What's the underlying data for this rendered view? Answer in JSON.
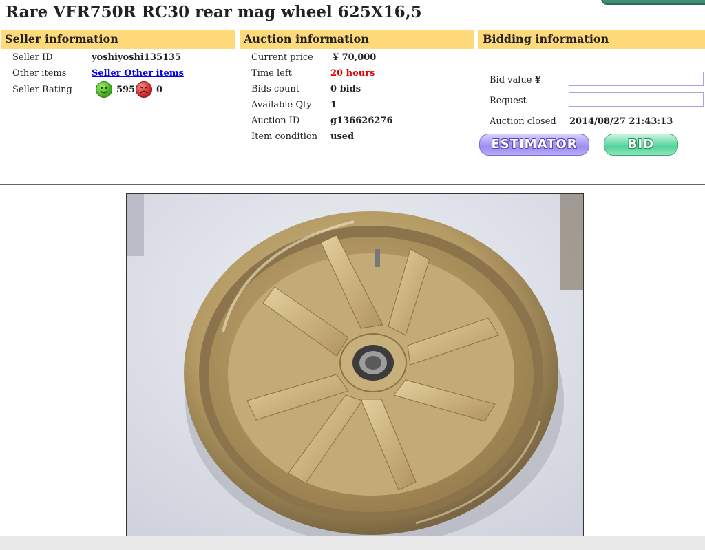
{
  "page": {
    "title": "Rare VFR750R RC30 rear mag wheel 625X16,5"
  },
  "seller": {
    "header": "Seller information",
    "id_label": "Seller ID",
    "id_value": "yoshiyoshi135135",
    "other_label": "Other items",
    "other_link": "Seller Other items",
    "rating_label": "Seller Rating",
    "good_count": "595",
    "bad_count": "0"
  },
  "auction": {
    "header": "Auction information",
    "rows": [
      {
        "label": "Current price",
        "value": "¥ 70,000"
      },
      {
        "label": "Time left",
        "value": "20 hours"
      },
      {
        "label": "Bids count",
        "value": "0 bids"
      },
      {
        "label": "Available Qty",
        "value": "1"
      },
      {
        "label": "Auction ID",
        "value": "g136626276"
      },
      {
        "label": "Item condition",
        "value": "used"
      }
    ]
  },
  "bidding": {
    "header": "Bidding information",
    "bid_value_label": "Bid value",
    "yen_symbol": "¥",
    "bid_value": "",
    "request_label": "Request",
    "request_value": "",
    "closed_label": "Auction closed",
    "closed_value": "2014/08/27 21:43:13",
    "estimator_label": "ESTIMATOR",
    "bid_label": "BID"
  },
  "colors": {
    "header_bg": "#ffd97a",
    "time_left": "#e30000",
    "link": "#0000ee"
  },
  "icons": {
    "good": "smiley-good-icon",
    "bad": "smiley-bad-icon"
  }
}
